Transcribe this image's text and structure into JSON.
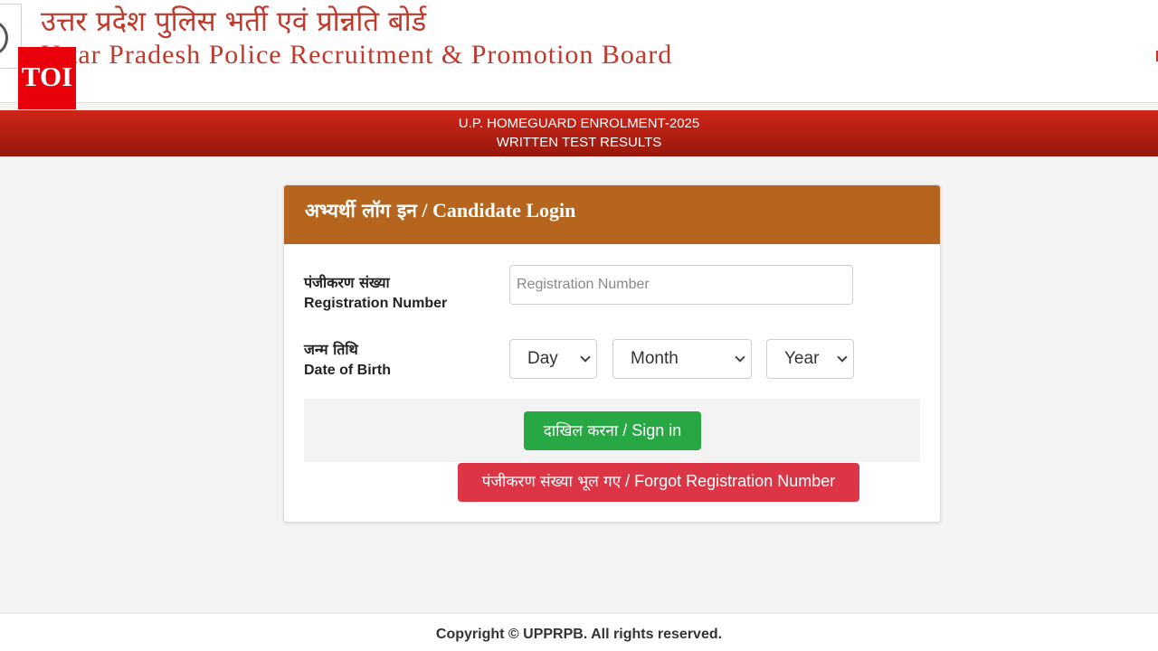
{
  "header": {
    "hindi_title": "उत्तर प्रदेश पुलिस भर्ती एवं प्रोन्नति बोर्ड",
    "english_title": "Uttar Pradesh Police Recruitment & Promotion Board",
    "toi_badge": "TOI"
  },
  "banner": {
    "line1": "U.P. HOMEGUARD ENROLMENT-2025",
    "line2": "WRITTEN TEST RESULTS"
  },
  "login": {
    "title_hindi": "अभ्यर्थी लॉग इन",
    "title_sep": " / ",
    "title_english": "Candidate Login",
    "registration": {
      "label_hindi": "पंजीकरण संख्या",
      "label_english": "Registration Number",
      "placeholder": "Registration Number",
      "value": ""
    },
    "dob": {
      "label_hindi": "जन्म तिथि",
      "label_english": "Date of Birth",
      "day_selected": "Day",
      "month_selected": "Month",
      "year_selected": "Year"
    },
    "signin_hindi": "दाखिल करना",
    "signin_english": " / Sign in",
    "forgot_hindi": "पंजीकरण संख्या भूल गए",
    "forgot_english": " / Forgot Registration Number"
  },
  "footer": {
    "copyright": "Copyright © UPPRPB. All rights reserved."
  },
  "colors": {
    "brand_red": "#c0392b",
    "banner_red": "#b01f12",
    "card_header": "#b5651d",
    "signin_green": "#28a745",
    "forgot_red": "#dc3545",
    "toi_red": "#e8000b"
  },
  "icons": [
    "up-police-emblem-icon",
    "chevron-down-icon"
  ]
}
